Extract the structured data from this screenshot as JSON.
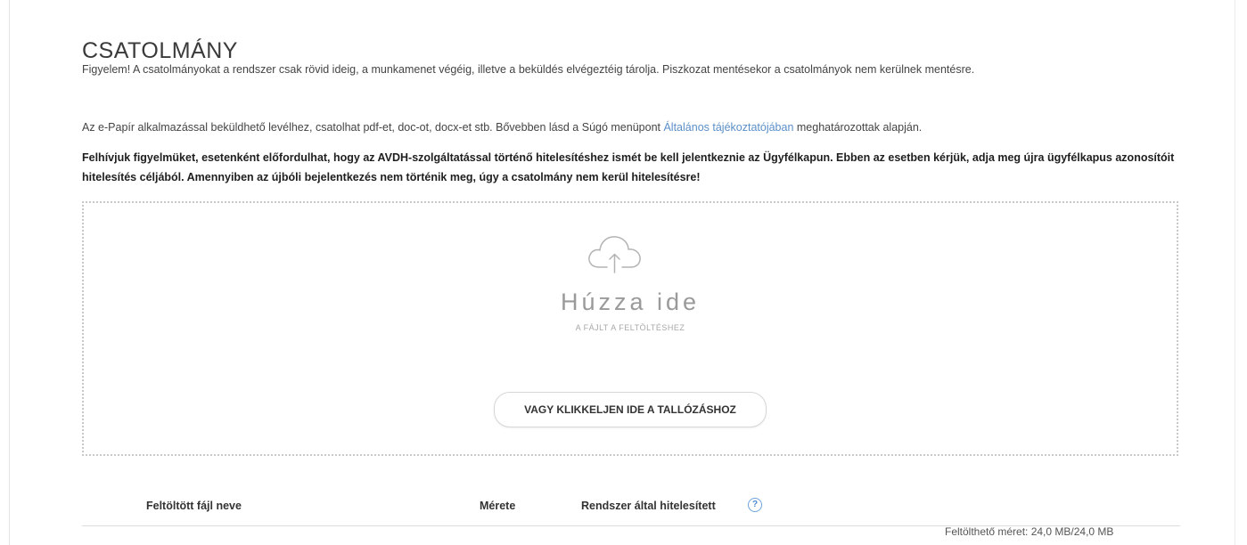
{
  "attachment": {
    "title": "CSATOLMÁNY",
    "warning_text": "Figyelem! A csatolmányokat a rendszer csak rövid ideig, a munkamenet végéig, illetve a beküldés elvégeztéig tárolja. Piszkozat mentésekor a csatolmányok nem kerülnek mentésre.",
    "info_prefix": "Az e-Papír alkalmazással beküldhető levélhez, csatolhat pdf-et, doc-ot, docx-et stb. Bővebben lásd a Súgó menüpont ",
    "info_link": "Általános tájékoztatójában",
    "info_suffix": " meghatározottak alapján.",
    "notice_text": "Felhívjuk figyelmüket, esetenként előfordulhat, hogy az AVDH-szolgáltatással történő hitelesítéshez ismét be kell jelentkeznie az Ügyfélkapun. Ebben az esetben kérjük, adja meg újra ügyfélkapus azonosítóit hitelesítés céljából. Amennyiben az újbóli bejelentkezés nem történik meg, úgy a csatolmány nem kerül hitelesítésre!"
  },
  "dropzone": {
    "icon": "cloud-upload-icon",
    "title": "Húzza ide",
    "subtitle": "A FÁJLT A FELTÖLTÉSHEZ",
    "browse_label": "VAGY KLIKKELJEN IDE A TALLÓZÁSHOZ"
  },
  "table": {
    "columns": [
      "Feltöltött fájl neve",
      "Mérete",
      "Rendszer által hitelesített"
    ],
    "help_icon": "question-mark-icon",
    "help_glyph": "?"
  },
  "footer": {
    "upload_limit": "Feltölthető méret: 24,0 MB/24,0 MB"
  },
  "colors": {
    "link": "#5b8fc9",
    "help_icon": "#6ea4dc",
    "dropzone_border": "#c9c9c9"
  }
}
